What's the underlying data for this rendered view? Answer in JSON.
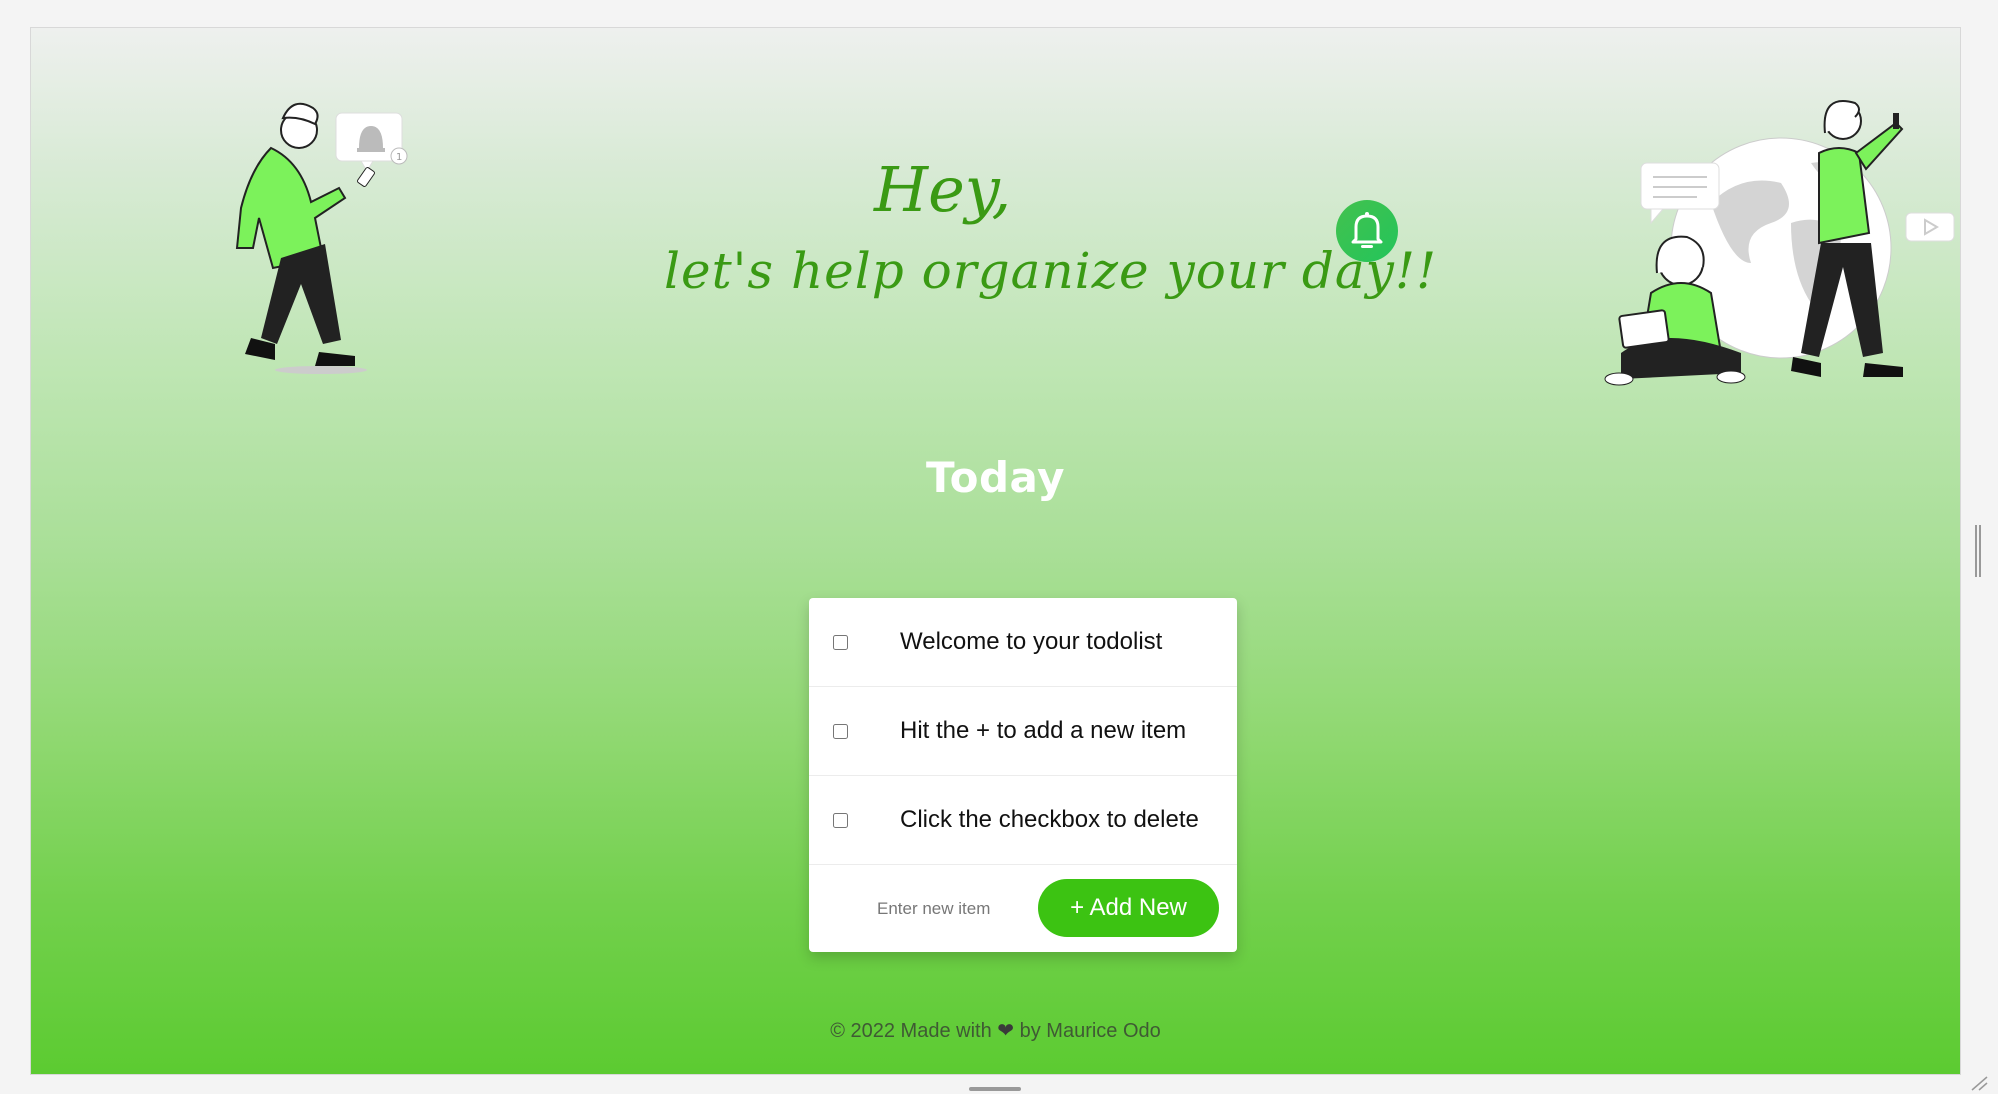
{
  "greeting": {
    "line1": "Hey,",
    "line2": "let's help organize your day!!"
  },
  "heading": "Today",
  "todos": [
    {
      "text": "Welcome to your todolist",
      "checked": false
    },
    {
      "text": "Hit the + to add a new item",
      "checked": false
    },
    {
      "text": "Click the checkbox to delete",
      "checked": false
    }
  ],
  "new_item": {
    "placeholder": "Enter new item",
    "value": ""
  },
  "add_button_label": "+ Add New",
  "footer": {
    "prefix": "© 2022 Made with",
    "heart": "❤",
    "suffix": "by Maurice Odo"
  },
  "colors": {
    "accent": "#3cc312",
    "greeting_text": "#3a9a14",
    "bell_bg": "#2bc455"
  },
  "icons": [
    "bell-icon",
    "heart-icon"
  ]
}
